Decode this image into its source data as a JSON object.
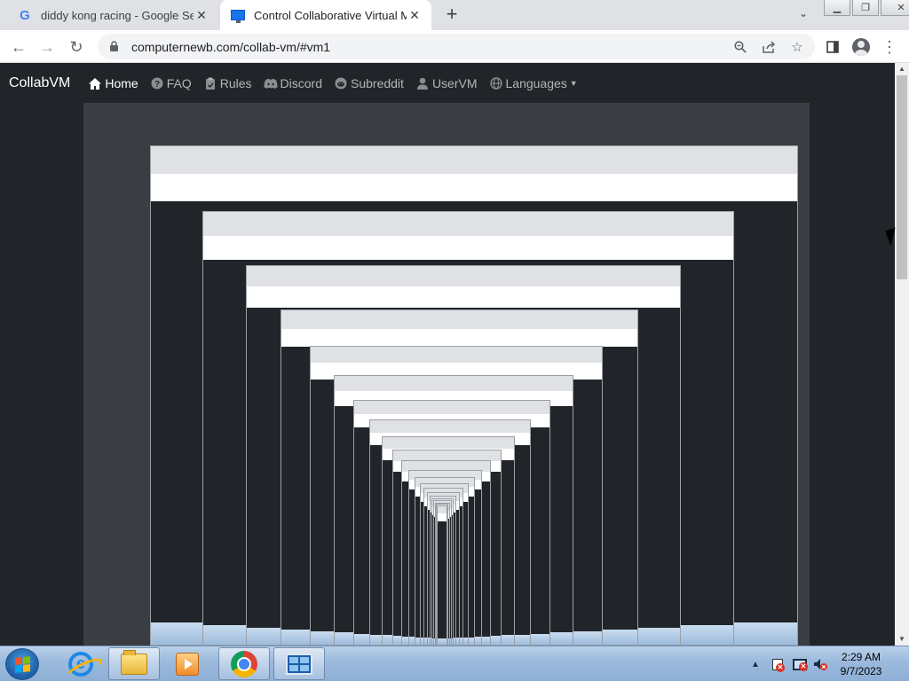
{
  "browser": {
    "tabs": [
      {
        "title": "diddy kong racing - Google Sear",
        "favicon": "google-g-icon",
        "active": false
      },
      {
        "title": "Control Collaborative Virtual Ma",
        "favicon": "monitor-icon",
        "active": true
      }
    ],
    "new_tab_label": "+",
    "url": "computernewb.com/collab-vm/#vm1"
  },
  "site": {
    "brand": "CollabVM",
    "nav": [
      {
        "label": "Home",
        "icon": "home-icon",
        "active": true
      },
      {
        "label": "FAQ",
        "icon": "question-circle-icon"
      },
      {
        "label": "Rules",
        "icon": "clipboard-icon"
      },
      {
        "label": "Discord",
        "icon": "discord-icon"
      },
      {
        "label": "Subreddit",
        "icon": "reddit-icon"
      },
      {
        "label": "UserVM",
        "icon": "user-icon"
      },
      {
        "label": "Languages",
        "icon": "globe-icon",
        "dropdown": true
      }
    ]
  },
  "taskbar": {
    "apps": [
      {
        "name": "Internet Explorer",
        "icon": "ie-icon",
        "open": false
      },
      {
        "name": "Windows Explorer",
        "icon": "folder-icon",
        "open": true
      },
      {
        "name": "Windows Media Player",
        "icon": "media-player-icon",
        "open": false
      },
      {
        "name": "Google Chrome",
        "icon": "chrome-icon",
        "open": true
      },
      {
        "name": "Remote Desktop",
        "icon": "remote-desktop-icon",
        "open": true
      }
    ],
    "time": "2:29 AM",
    "date": "9/7/2023"
  },
  "colors": {
    "page_bg": "#212529",
    "tabstrip_bg": "#dfe1e5",
    "taskbar": "#9bb9dd"
  }
}
